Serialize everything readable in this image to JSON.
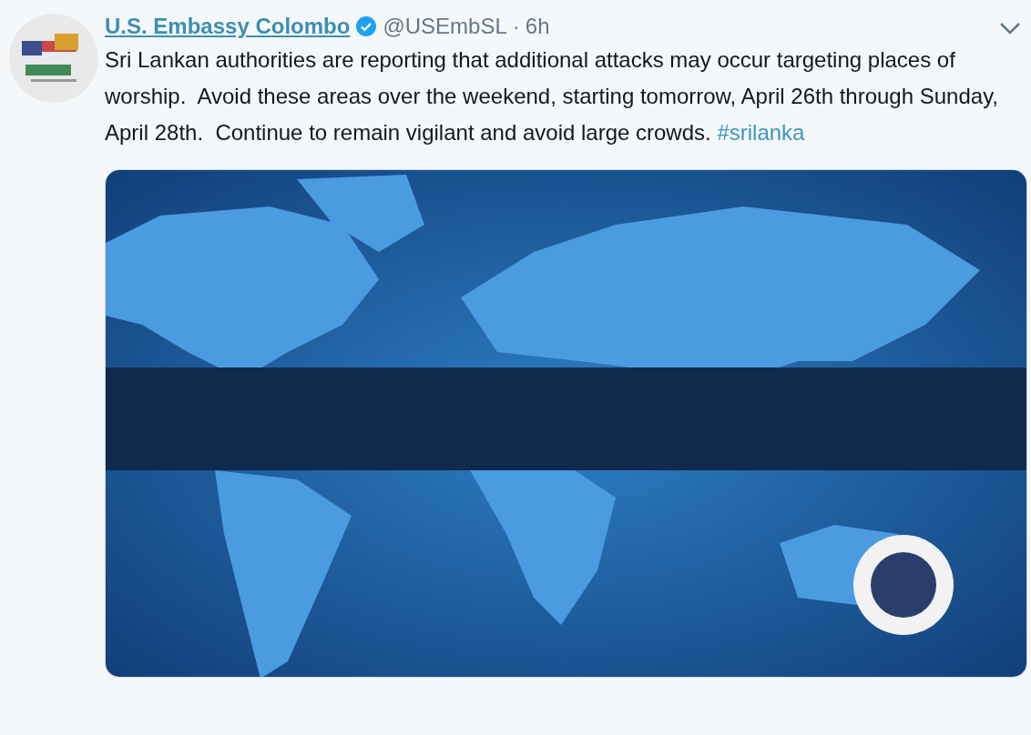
{
  "tweet": {
    "author": {
      "name": "U.S. Embassy Colombo",
      "verified": true,
      "handle": "@USEmbSL",
      "separator": "·",
      "time": "6h"
    },
    "text": "Sri Lankan authorities are reporting that additional attacks may occur targeting places of worship.  Avoid these areas over the weekend, starting tomorrow, April 26th through Sunday, April 28th.  Continue to remain vigilant and avoid large crowds. ",
    "hashtag": "#srilanka"
  }
}
